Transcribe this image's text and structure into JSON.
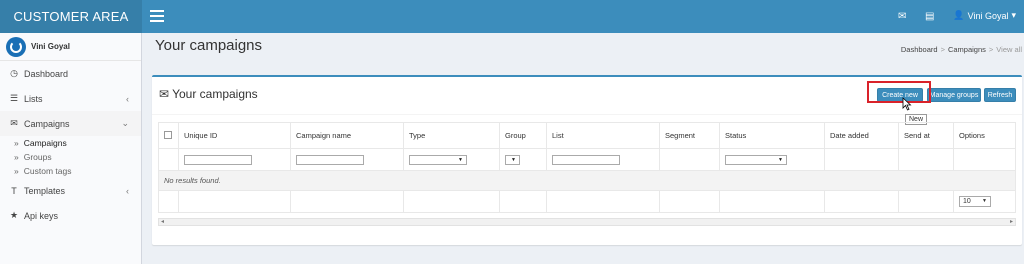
{
  "app": {
    "brand": "CUSTOMER AREA"
  },
  "topbar": {
    "user_name": "Vini Goyal"
  },
  "sidebar": {
    "user_name": "Vini Goyal",
    "items": [
      {
        "label": "Dashboard"
      },
      {
        "label": "Lists"
      },
      {
        "label": "Campaigns"
      },
      {
        "label": "Templates"
      },
      {
        "label": "Api keys"
      }
    ],
    "campaign_sub": [
      {
        "label": "Campaigns"
      },
      {
        "label": "Groups"
      },
      {
        "label": "Custom tags"
      }
    ]
  },
  "header": {
    "title": "Your campaigns",
    "breadcrumb": [
      "Dashboard",
      "Campaigns",
      "View all"
    ]
  },
  "box": {
    "title": "Your campaigns",
    "buttons": {
      "create": "Create new",
      "groups": "Manage groups",
      "refresh": "Refresh"
    },
    "tooltip": "New"
  },
  "table": {
    "columns": [
      "Unique ID",
      "Campaign name",
      "Type",
      "Group",
      "List",
      "Segment",
      "Status",
      "Date added",
      "Send at",
      "Options"
    ],
    "empty_text": "No results found.",
    "per_page": "10"
  },
  "colors": {
    "brand": "#367fa9",
    "topbar": "#3c8dbc",
    "highlight": "#d9222a"
  }
}
